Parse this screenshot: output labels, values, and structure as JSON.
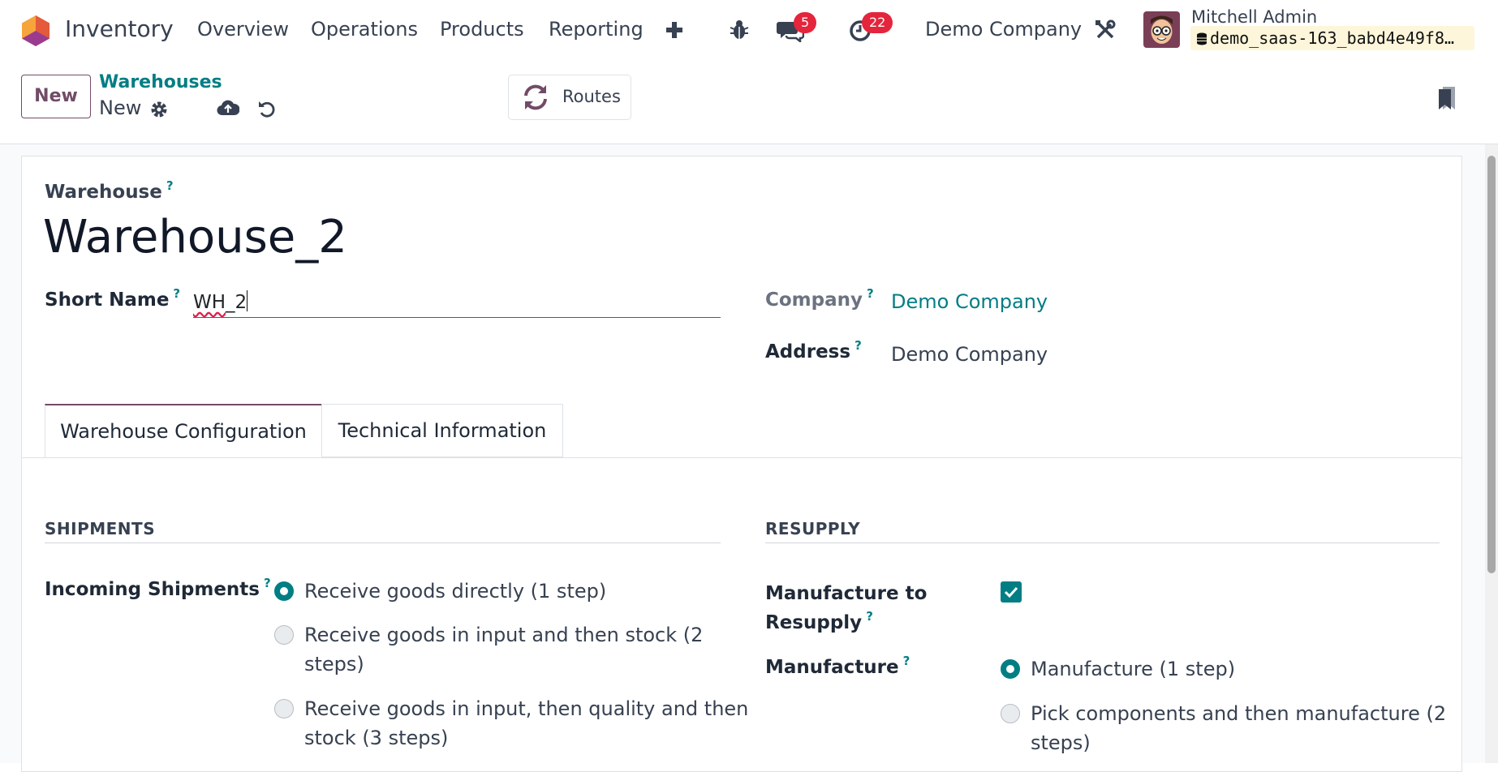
{
  "navbar": {
    "app_name": "Inventory",
    "menu": [
      "Overview",
      "Operations",
      "Products",
      "Reporting"
    ],
    "messages_count": "5",
    "activities_count": "22",
    "company": "Demo Company",
    "user_name": "Mitchell Admin",
    "database": "demo_saas-163_babd4e49f8…"
  },
  "control_panel": {
    "new_label": "New",
    "breadcrumb_parent": "Warehouses",
    "breadcrumb_current": "New",
    "routes_label": "Routes"
  },
  "form": {
    "section_label": "Warehouse",
    "name_value": "Warehouse_2",
    "short_name_label": "Short Name",
    "short_name_value_prefix": "WH",
    "short_name_value_suffix": "_2",
    "company_label": "Company",
    "company_value": "Demo Company",
    "address_label": "Address",
    "address_value": "Demo Company",
    "help_mark": "?"
  },
  "tabs": [
    "Warehouse Configuration",
    "Technical Information"
  ],
  "shipments": {
    "title": "SHIPMENTS",
    "incoming_label": "Incoming Shipments",
    "options": [
      "Receive goods directly (1 step)",
      "Receive goods in input and then stock (2",
      "steps)",
      "Receive goods in input, then quality and then",
      "stock (3 steps)"
    ]
  },
  "resupply": {
    "title": "RESUPPLY",
    "manufacture_to_resupply_label_1": "Manufacture to",
    "manufacture_to_resupply_label_2": "Resupply",
    "manufacture_to_resupply_checked": true,
    "manufacture_label": "Manufacture",
    "options": [
      "Manufacture (1 step)",
      "Pick components and then manufacture (2",
      "steps)"
    ]
  },
  "colors": {
    "brand": "#714b67",
    "accent": "#017e84",
    "badge": "#e4253b"
  },
  "icons": [
    "odoo-logo-icon",
    "plus-icon",
    "bug-icon",
    "chat-icon",
    "clock-icon",
    "tools-icon",
    "database-icon",
    "gear-icon",
    "cloud-upload-icon",
    "undo-icon",
    "refresh-icon",
    "bookmark-icon",
    "check-icon"
  ]
}
